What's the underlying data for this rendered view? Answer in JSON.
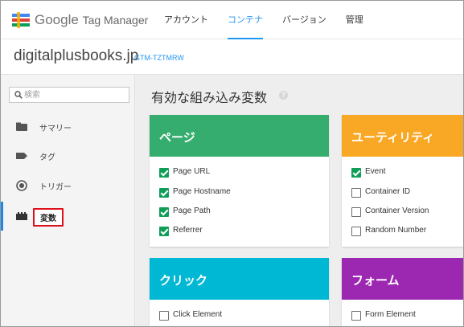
{
  "app": {
    "logo_brand": "Google",
    "logo_product": "Tag Manager"
  },
  "nav": {
    "tabs": [
      {
        "label": "アカウント"
      },
      {
        "label": "コンテナ"
      },
      {
        "label": "バージョン"
      },
      {
        "label": "管理"
      }
    ],
    "active_tab": "コンテナ"
  },
  "account": {
    "name": "digitalplusbooks.jp",
    "container_id": "GTM-TZTMRW"
  },
  "sidebar": {
    "search_placeholder": "検索",
    "items": [
      {
        "label": "サマリー",
        "icon": "folder-icon"
      },
      {
        "label": "タグ",
        "icon": "tag-icon"
      },
      {
        "label": "トリガー",
        "icon": "trigger-icon"
      },
      {
        "label": "変数",
        "icon": "variables-icon"
      }
    ],
    "active_item": "変数"
  },
  "main": {
    "title": "有効な組み込み変数",
    "help_symbol": "?"
  },
  "cards": {
    "pages": {
      "title": "ページ",
      "color": "#35ad6e",
      "items": [
        {
          "label": "Page URL",
          "checked": true
        },
        {
          "label": "Page Hostname",
          "checked": true
        },
        {
          "label": "Page Path",
          "checked": true
        },
        {
          "label": "Referrer",
          "checked": true
        }
      ]
    },
    "utilities": {
      "title": "ユーティリティ",
      "color": "#f9a825",
      "items": [
        {
          "label": "Event",
          "checked": true
        },
        {
          "label": "Container ID",
          "checked": false
        },
        {
          "label": "Container Version",
          "checked": false
        },
        {
          "label": "Random Number",
          "checked": false
        }
      ]
    },
    "clicks": {
      "title": "クリック",
      "color": "#00b8d4",
      "items": [
        {
          "label": "Click Element",
          "checked": false
        }
      ]
    },
    "forms": {
      "title": "フォーム",
      "color": "#9c27b0",
      "items": [
        {
          "label": "Form Element",
          "checked": false
        }
      ]
    }
  },
  "colors": {
    "accent_blue": "#2196f3",
    "highlight_red": "#e0101a",
    "check_green": "#0f9d58"
  }
}
